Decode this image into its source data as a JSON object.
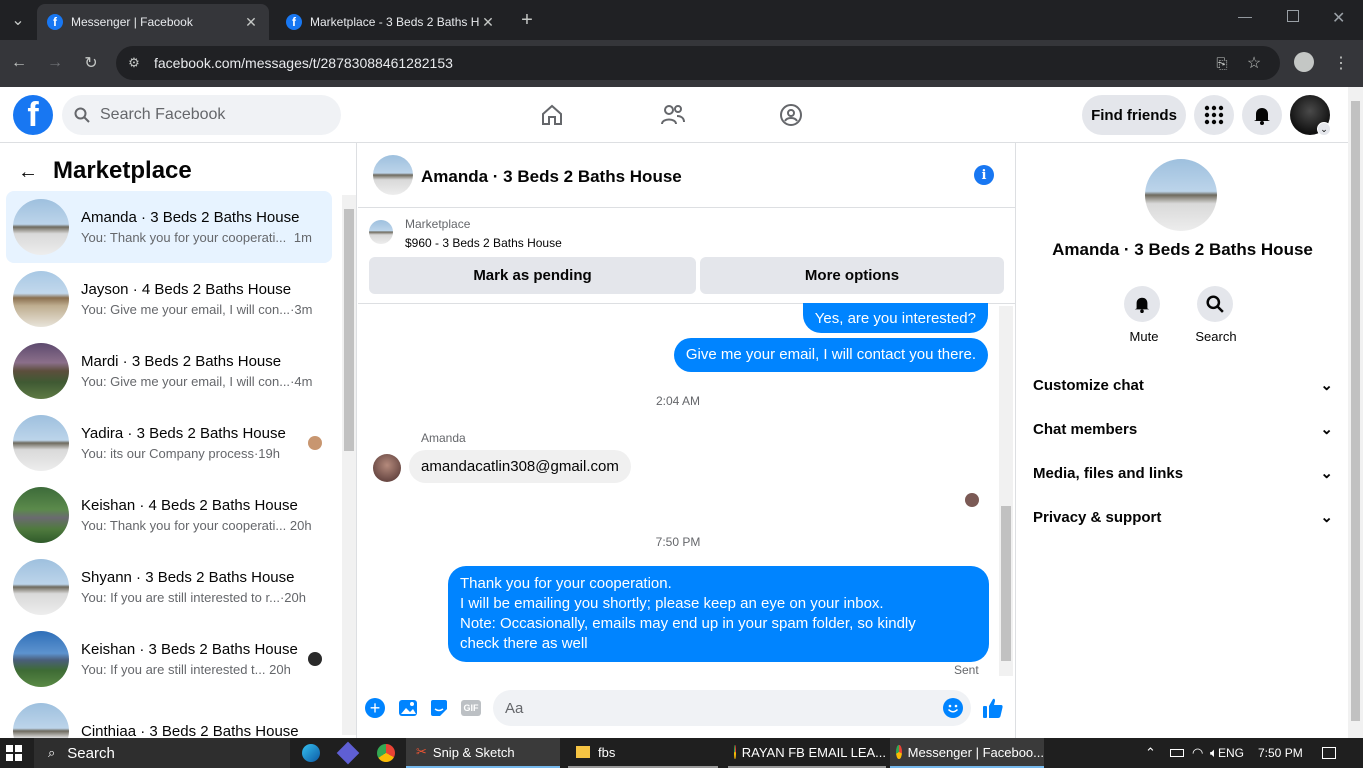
{
  "browser": {
    "tabs": [
      {
        "title": "Messenger | Facebook",
        "active": true
      },
      {
        "title": "Marketplace - 3 Beds 2 Baths H",
        "active": false
      }
    ],
    "url": "facebook.com/messages/t/28783088461282153"
  },
  "fb_header": {
    "search_placeholder": "Search Facebook",
    "find_friends": "Find friends"
  },
  "sidebar": {
    "title": "Marketplace",
    "conversations": [
      {
        "name": "Amanda · 3 Beds 2 Baths House",
        "snippet": "You: Thank you for your cooperati...",
        "time": "1m",
        "selected": true
      },
      {
        "name": "Jayson · 4 Beds 2 Baths House",
        "snippet": "You: Give me your email, I will con...",
        "time": "·3m"
      },
      {
        "name": "Mardi · 3 Beds 2 Baths House",
        "snippet": "You: Give me your email, I will con...",
        "time": "·4m"
      },
      {
        "name": "Yadira · 3 Beds 2 Baths House",
        "snippet": "You: its our Company process",
        "time": "·19h"
      },
      {
        "name": "Keishan · 4 Beds 2 Baths House",
        "snippet": "You: Thank you for your cooperati...",
        "time": "20h"
      },
      {
        "name": "Shyann · 3 Beds 2 Baths House",
        "snippet": "You: If you are still interested to r...",
        "time": "·20h"
      },
      {
        "name": "Keishan · 3 Beds 2 Baths House",
        "snippet": "You: If you are still interested t...",
        "time": "20h"
      },
      {
        "name": "Cinthiaa · 3 Beds 2 Baths House",
        "snippet": "",
        "time": ""
      }
    ]
  },
  "chat": {
    "title": "Amanda · 3 Beds 2 Baths House",
    "listing_label": "Marketplace",
    "listing_title": "$960 - 3 Beds 2 Baths House",
    "mark_pending": "Mark as pending",
    "more_options": "More options",
    "messages": {
      "m1": "Yes, are you interested?",
      "m2": "Give me your email, I will contact you there.",
      "ts1": "2:04 AM",
      "sender": "Amanda",
      "m3": "amandacatlin308@gmail.com",
      "ts2": "7:50 PM",
      "m4_l1": "Thank you for your cooperation.",
      "m4_l2": "I will be emailing you shortly; please keep an eye on your inbox.",
      "m4_l3": "Note: Occasionally, emails may end up in your spam folder, so kindly",
      "m4_l4": "check there as well",
      "status": "Sent"
    },
    "composer_placeholder": "Aa"
  },
  "details": {
    "name": "Amanda · 3 Beds 2 Baths House",
    "mute": "Mute",
    "search": "Search",
    "sections": [
      "Customize chat",
      "Chat members",
      "Media, files and links",
      "Privacy & support"
    ]
  },
  "taskbar": {
    "search": "Search",
    "apps": [
      "Snip & Sketch",
      "fbs",
      "RAYAN FB EMAIL LEA...",
      "Messenger | Faceboo..."
    ],
    "lang": "ENG",
    "time": "7:50 PM"
  },
  "colors": {
    "brand": "#1877f2",
    "bubble": "#0084ff",
    "selected": "#e7f3ff"
  }
}
